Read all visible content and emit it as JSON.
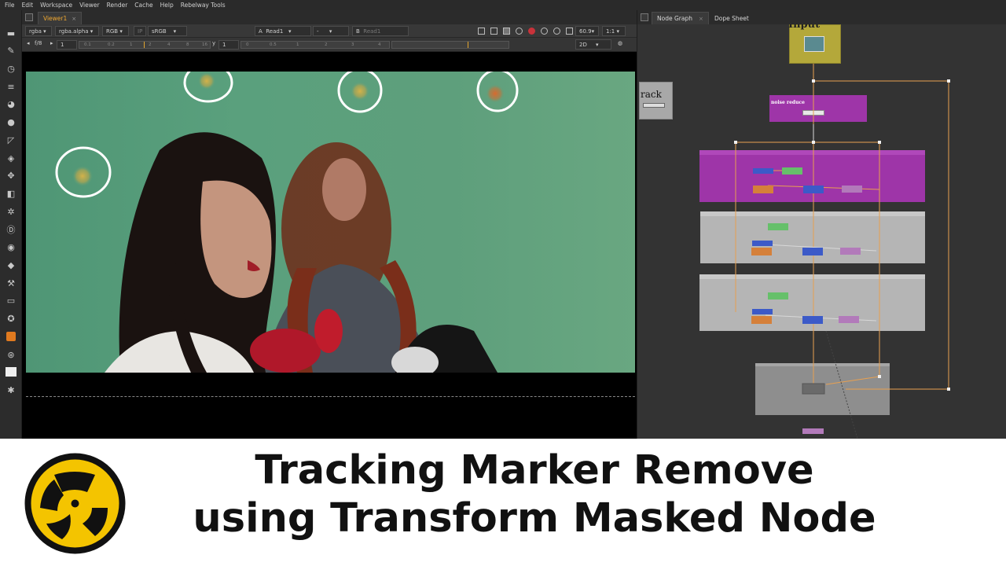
{
  "menu": [
    "File",
    "Edit",
    "Workspace",
    "Viewer",
    "Render",
    "Cache",
    "Help",
    "Rebelway Tools"
  ],
  "viewer": {
    "tab_label": "Viewer1",
    "tab_close": "×",
    "channels": "rgba",
    "channel_alpha": "rgba.alpha",
    "rgb": "RGB",
    "ip": "IP",
    "colorspace": "sRGB",
    "a_label": "A",
    "a_input": "Read1",
    "a_op": "-",
    "b_label": "B",
    "b_input": "Read1",
    "zoom": "60.9",
    "ratio": "1:1",
    "fstop": "f/8",
    "gain": "1",
    "y_label": "y",
    "gamma": "1",
    "mode": "2D",
    "gain_ticks": [
      "0.1",
      "0.2",
      "1",
      "2",
      "4",
      "8",
      "16"
    ],
    "gamma_ticks": [
      "0",
      "0.5",
      "1",
      "2",
      "3",
      "4"
    ]
  },
  "graph": {
    "tabs": [
      {
        "label": "Node Graph",
        "close": "×"
      },
      {
        "label": "Dope Sheet",
        "close": ""
      }
    ],
    "input_node_label": "Input",
    "track_node_label": "rack",
    "backdrop_label": "noise reduce"
  },
  "banner": {
    "title_line1": "Tracking Marker Remove",
    "title_line2": "using Transform Masked Node"
  },
  "colors": {
    "accent_orange": "#f0a830",
    "backdrop_purple": "#9e35a8",
    "backdrop_gray": "#b5b5b5",
    "logo_yellow": "#f4c400"
  }
}
